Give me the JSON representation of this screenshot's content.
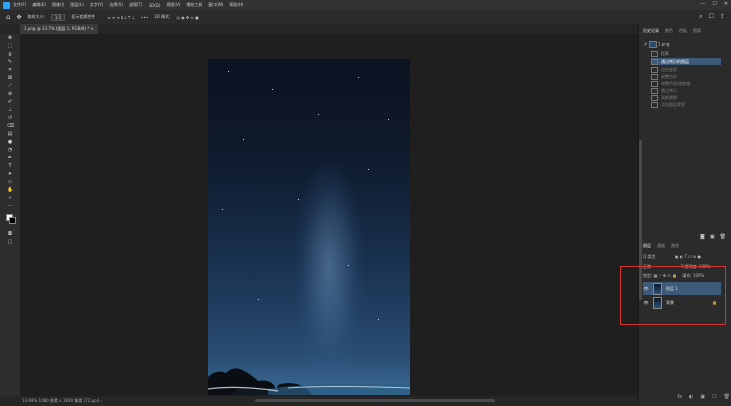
{
  "menu": [
    "文件(F)",
    "编辑(E)",
    "图像(I)",
    "图层(L)",
    "文字(Y)",
    "选择(S)",
    "滤镜(T)",
    "3D(D)",
    "视图(V)",
    "增效工具",
    "窗口(W)",
    "帮助(H)"
  ],
  "window_controls": [
    "—",
    "☐",
    "✕"
  ],
  "options_bar": {
    "home_icon": "home-icon",
    "sample_label": "取样大小:",
    "sample_value": "1:1",
    "auto_select": "显示变换控件",
    "align_icons": "≡ ≡ ≡ ⫼ ⟘ ⟙ ⊥",
    "more": "•••",
    "mode3d": "3D 模式:"
  },
  "options_right": [
    "⌕",
    "☐",
    "⇪"
  ],
  "document": {
    "tab_label": "1.png @ 13.7% (图层 1, RGB/8) *",
    "close": "×"
  },
  "status": {
    "text": "13.69%   1080 像素 x 1920 像素 (72 ppi)   ›"
  },
  "panels": {
    "history_tabs": [
      "历史记录",
      "颜色",
      "色板",
      "图案"
    ],
    "history_snapshot": "1.png",
    "history_items": [
      {
        "label": "打开",
        "state": "normal"
      },
      {
        "label": "通过拷贝的图层",
        "state": "selected"
      },
      {
        "label": "自由变换",
        "state": "dim"
      },
      {
        "label": "调整色阶",
        "state": "dim"
      },
      {
        "label": "调整色相/饱和度",
        "state": "dim"
      },
      {
        "label": "通过拷贝",
        "state": "dim"
      },
      {
        "label": "高斯模糊",
        "state": "dim"
      },
      {
        "label": "添加图层蒙版",
        "state": "dim"
      }
    ],
    "layers_tabs": [
      "图层",
      "通道",
      "路径"
    ],
    "filter_label": "Q 类型",
    "blend_mode": "正常",
    "opacity_label": "不透明度:",
    "opacity_value": "100%",
    "lock_label": "锁定:",
    "fill_label": "填充:",
    "fill_value": "100%",
    "layers": [
      {
        "name": "图层 1",
        "selected": true,
        "locked": false
      },
      {
        "name": "背景",
        "selected": false,
        "locked": true
      }
    ],
    "bottom_icons": [
      "fx",
      "◐",
      "▣",
      "☐",
      "🗑"
    ]
  },
  "accent": "#2fa3f7",
  "highlight": "#d93030"
}
